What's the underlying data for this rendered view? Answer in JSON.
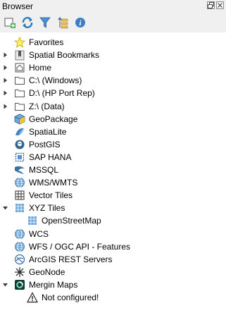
{
  "panel": {
    "title": "Browser"
  },
  "toolbar": {
    "buttons": [
      {
        "name": "add-selected-layers",
        "icon": "add-layer-icon"
      },
      {
        "name": "refresh",
        "icon": "refresh-icon"
      },
      {
        "name": "filter-browser",
        "icon": "filter-icon"
      },
      {
        "name": "collapse-all",
        "icon": "collapse-all-icon"
      },
      {
        "name": "properties-widget",
        "icon": "info-icon"
      }
    ]
  },
  "tree": {
    "items": [
      {
        "label": "Favorites",
        "icon": "star-icon",
        "expander": "none"
      },
      {
        "label": "Spatial Bookmarks",
        "icon": "bookmarks-icon",
        "expander": "collapsed"
      },
      {
        "label": "Home",
        "icon": "home-folder-icon",
        "expander": "collapsed"
      },
      {
        "label": "C:\\ (Windows)",
        "icon": "folder-icon",
        "expander": "collapsed"
      },
      {
        "label": "D:\\ (HP Port Rep)",
        "icon": "folder-icon",
        "expander": "collapsed"
      },
      {
        "label": "Z:\\ (Data)",
        "icon": "folder-icon",
        "expander": "collapsed"
      },
      {
        "label": "GeoPackage",
        "icon": "geopackage-icon",
        "expander": "none"
      },
      {
        "label": "SpatiaLite",
        "icon": "spatialite-icon",
        "expander": "none"
      },
      {
        "label": "PostGIS",
        "icon": "postgis-icon",
        "expander": "none"
      },
      {
        "label": "SAP HANA",
        "icon": "sap-hana-icon",
        "expander": "none"
      },
      {
        "label": "MSSQL",
        "icon": "mssql-icon",
        "expander": "none"
      },
      {
        "label": "WMS/WMTS",
        "icon": "globe-icon",
        "expander": "none"
      },
      {
        "label": "Vector Tiles",
        "icon": "vector-tiles-icon",
        "expander": "none"
      },
      {
        "label": "XYZ Tiles",
        "icon": "xyz-tiles-icon",
        "expander": "expanded"
      },
      {
        "label": "OpenStreetMap",
        "icon": "xyz-tiles-icon",
        "expander": "none",
        "child": true
      },
      {
        "label": "WCS",
        "icon": "globe-icon",
        "expander": "none"
      },
      {
        "label": "WFS / OGC API - Features",
        "icon": "globe-icon",
        "expander": "none"
      },
      {
        "label": "ArcGIS REST Servers",
        "icon": "arcgis-icon",
        "expander": "none"
      },
      {
        "label": "GeoNode",
        "icon": "geonode-icon",
        "expander": "none"
      },
      {
        "label": "Mergin Maps",
        "icon": "mergin-maps-icon",
        "expander": "expanded"
      },
      {
        "label": "Not configured!",
        "icon": "warning-icon",
        "expander": "none",
        "child": true
      }
    ]
  }
}
